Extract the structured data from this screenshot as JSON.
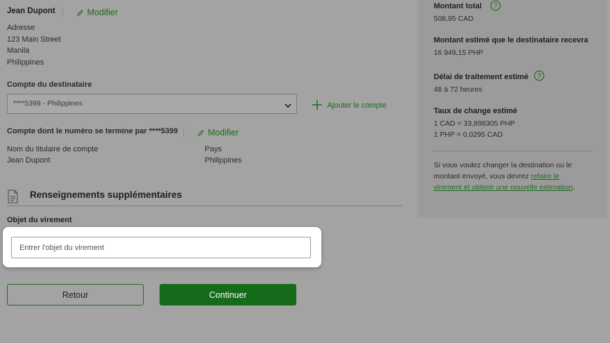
{
  "recipient": {
    "name": "Jean Dupont",
    "edit_label": "Modifier",
    "address_label": "Adresse",
    "address_lines": [
      "123 Main Street",
      "Manila",
      "Philippines"
    ]
  },
  "account": {
    "label": "Compte du destinataire",
    "selected": "****5399 - Philippines",
    "add_label": "Ajouter le compte",
    "ending_title": "Compte dont le numéro se termine par ****5399",
    "edit_label": "Modifier",
    "holder_label": "Nom du titulaire de compte",
    "holder_value": "Jean Dupont",
    "country_label": "Pays",
    "country_value": "Philippines"
  },
  "additional": {
    "title": "Renseignements supplémentaires",
    "purpose_label": "Objet du virement",
    "purpose_placeholder": "Entrer l'objet du virement",
    "purpose_value": ""
  },
  "buttons": {
    "back": "Retour",
    "continue": "Continuer"
  },
  "summary": {
    "total_label": "Montant total",
    "total_value": "508,95 CAD",
    "estimated_label": "Montant estimé que le destinataire recevra",
    "estimated_value": "16 949,15 PHP",
    "delay_label": "Délai de traitement estimé",
    "delay_value": "48 à 72 heures",
    "rate_label": "Taux de change estimé",
    "rate_line1": "1 CAD = 33,898305 PHP",
    "rate_line2": "1 PHP = 0,0295 CAD",
    "note_text": "Si vous voulez changer la destination ou le montant envoyé, vous devrez ",
    "note_link": "refaire le virement et obtenir une nouvelle estimation",
    "note_end": "."
  },
  "colors": {
    "accent_green": "#1f6b1f",
    "button_green": "#146b19",
    "overlay_gray": "#a3a3a3",
    "panel_gray": "#9b9b9b"
  },
  "icons": {
    "edit": "pencil-icon",
    "dropdown": "chevron-down-icon",
    "add": "plus-icon",
    "section": "document-icon",
    "help": "help-circle-icon"
  }
}
